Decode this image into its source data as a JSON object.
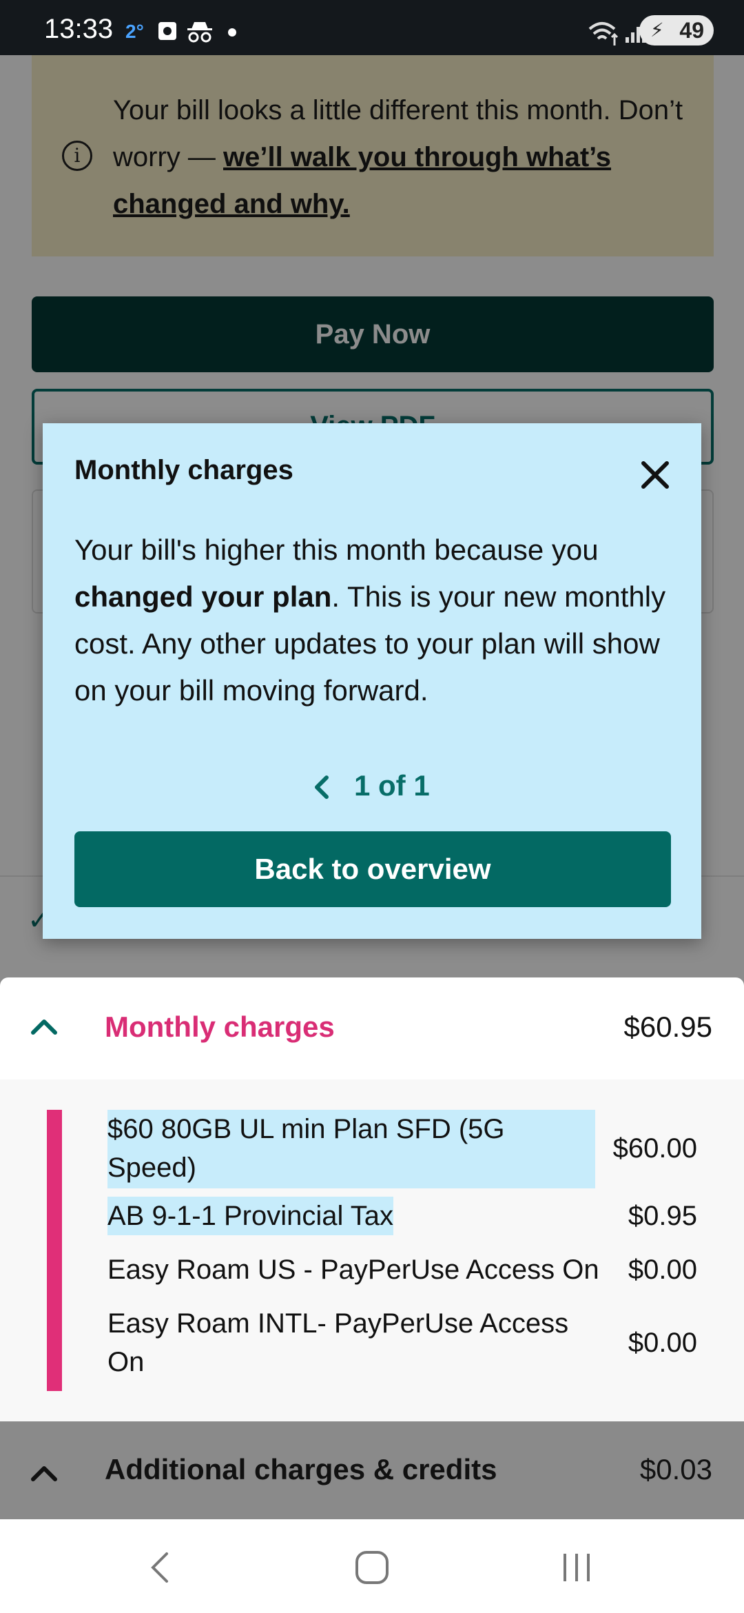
{
  "status_bar": {
    "time": "13:33",
    "temperature": "2°",
    "battery": "49",
    "icons": [
      "camera-icon",
      "incognito-icon",
      "dot-icon",
      "wifi-icon",
      "signal-icon",
      "battery-icon"
    ]
  },
  "notice": {
    "line1": "Your bill looks a little different this month. Don’t worry — ",
    "link": "we’ll walk you through what’s changed and why."
  },
  "buttons": {
    "pay_now": "Pay Now",
    "view_pdf": "View PDF"
  },
  "modal": {
    "title": "Monthly charges",
    "body_before": "Your bill's higher this month because you ",
    "body_bold": "changed your plan",
    "body_after": ". This is your new monthly cost. Any other updates to your plan will show on your bill moving forward.",
    "pager": "1 of 1",
    "back_button": "Back to overview"
  },
  "monthly_charges": {
    "title": "Monthly charges",
    "total": "$60.95",
    "items": [
      {
        "label": "$60 80GB UL min Plan SFD (5G Speed)",
        "amount": "$60.00"
      },
      {
        "label": "AB 9-1-1 Provincial Tax",
        "amount": "$0.95"
      },
      {
        "label": "Easy Roam US - PayPerUse Access On",
        "amount": "$0.00"
      },
      {
        "label": "Easy Roam INTL- PayPerUse Access On",
        "amount": "$0.00"
      }
    ]
  },
  "additional_charges": {
    "title": "Additional charges & credits",
    "total": "$0.03"
  },
  "colors": {
    "accent_teal": "#036963",
    "accent_pink": "#e02f78",
    "modal_bg": "#c7ecfb",
    "notice_bg": "#f7eec8"
  }
}
